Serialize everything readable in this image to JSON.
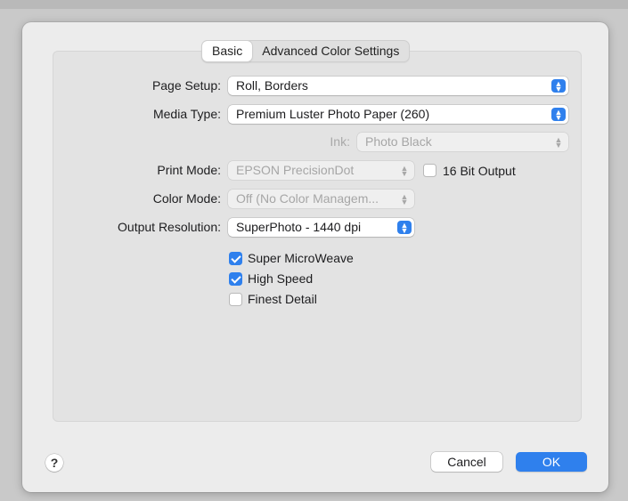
{
  "tabs": [
    {
      "label": "Basic",
      "active": true
    },
    {
      "label": "Advanced Color Settings",
      "active": false
    }
  ],
  "page_setup": {
    "label": "Page Setup:",
    "value": "Roll, Borders"
  },
  "media_type": {
    "label": "Media Type:",
    "value": "Premium Luster Photo Paper (260)"
  },
  "ink": {
    "label": "Ink:",
    "value": "Photo Black"
  },
  "print_mode": {
    "label": "Print Mode:",
    "value": "EPSON PrecisionDot"
  },
  "bit_output": {
    "label": "16 Bit Output",
    "checked": false
  },
  "color_mode": {
    "label": "Color Mode:",
    "value": "Off (No Color Managem..."
  },
  "output_resolution": {
    "label": "Output Resolution:",
    "value": "SuperPhoto - 1440 dpi"
  },
  "options": [
    {
      "label": "Super MicroWeave",
      "checked": true
    },
    {
      "label": "High Speed",
      "checked": true
    },
    {
      "label": "Finest Detail",
      "checked": false
    }
  ],
  "footer": {
    "help": "?",
    "cancel": "Cancel",
    "ok": "OK"
  },
  "colors": {
    "accent": "#2f80ed",
    "dialog_bg": "#ececec"
  }
}
